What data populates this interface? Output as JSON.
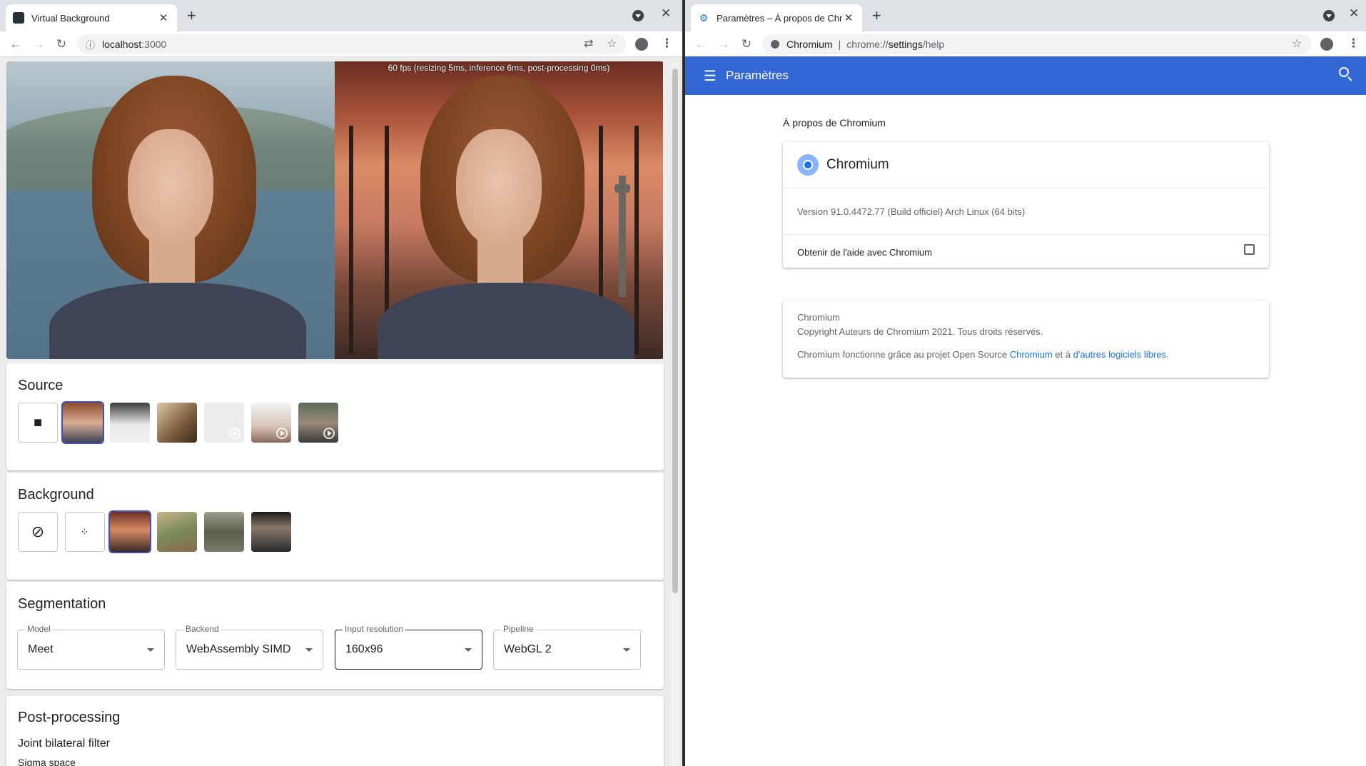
{
  "left_window": {
    "tab_title": "Virtual Background",
    "address": {
      "host": "localhost",
      "port": ":3000"
    },
    "fps_overlay": "60 fps (resizing 5ms, inference 6ms, post-processing 0ms)",
    "source": {
      "title": "Source",
      "items": [
        "camera",
        "woman-photo",
        "doctor-photo",
        "friends-photo",
        "blank-video",
        "office-video",
        "man-video"
      ]
    },
    "background": {
      "title": "Background",
      "items": [
        "none",
        "blur",
        "restaurant-window",
        "hills",
        "rock",
        "city-window"
      ]
    },
    "segmentation": {
      "title": "Segmentation",
      "fields": [
        {
          "label": "Model",
          "value": "Meet"
        },
        {
          "label": "Backend",
          "value": "WebAssembly SIMD"
        },
        {
          "label": "Input resolution",
          "value": "160x96"
        },
        {
          "label": "Pipeline",
          "value": "WebGL 2"
        }
      ]
    },
    "post_processing": {
      "title": "Post-processing",
      "subtitle": "Joint bilateral filter",
      "sigma_label": "Sigma space"
    }
  },
  "right_window": {
    "tab_title": "Paramètres – À propos de Chromium",
    "address": {
      "site": "Chromium",
      "scheme": "chrome://",
      "host": "settings",
      "path": "/help"
    },
    "header_title": "Paramètres",
    "page_heading": "À propos de Chromium",
    "product_name": "Chromium",
    "version": "Version 91.0.4472.77 (Build officiel) Arch Linux (64 bits)",
    "help_link": "Obtenir de l'aide avec Chromium",
    "about": {
      "name": "Chromium",
      "copyright": "Copyright Auteurs de Chromium 2021. Tous droits réservés.",
      "oss_prefix": "Chromium fonctionne grâce au projet Open Source ",
      "oss_link1": "Chromium",
      "oss_mid": " et à ",
      "oss_link2": "d'autres logiciels libres",
      "oss_suffix": "."
    }
  },
  "colors": {
    "settings_blue": "#3367d6",
    "link_blue": "#1a73e8",
    "selected_outline": "#3f51b5"
  }
}
